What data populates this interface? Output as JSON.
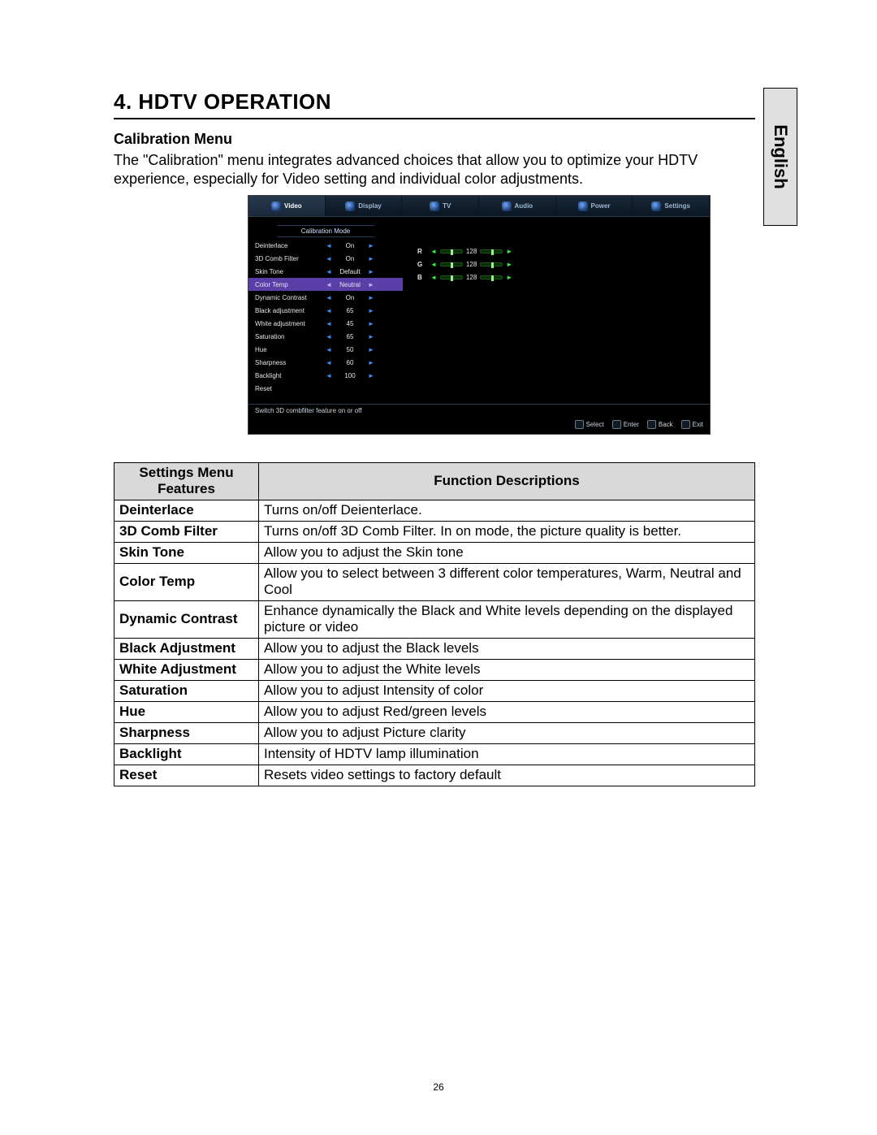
{
  "side_tab": "English",
  "heading": "4.​     HDTV OPERATION",
  "subheading": "Calibration Menu",
  "intro": "The \"Calibration\" menu integrates advanced  choices that allow you to optimize your HDTV experience, especially for Video setting and individual color adjustments.",
  "osd": {
    "tabs": [
      {
        "label": "Video",
        "active": true
      },
      {
        "label": "Display",
        "active": false
      },
      {
        "label": "TV",
        "active": false
      },
      {
        "label": "Audio",
        "active": false
      },
      {
        "label": "Power",
        "active": false
      },
      {
        "label": "Settings",
        "active": false
      }
    ],
    "panel_title": "Calibration Mode",
    "rows": [
      {
        "label": "Deinterlace",
        "value": "On",
        "selected": false,
        "has_arrows": true
      },
      {
        "label": "3D Comb Filter",
        "value": "On",
        "selected": false,
        "has_arrows": true
      },
      {
        "label": "Skin Tone",
        "value": "Default",
        "selected": false,
        "has_arrows": true
      },
      {
        "label": "Color Temp",
        "value": "Neutral",
        "selected": true,
        "has_arrows": true
      },
      {
        "label": "Dynamic Contrast",
        "value": "On",
        "selected": false,
        "has_arrows": true
      },
      {
        "label": "Black adjustment",
        "value": "65",
        "selected": false,
        "has_arrows": true
      },
      {
        "label": "White adjustment",
        "value": "45",
        "selected": false,
        "has_arrows": true
      },
      {
        "label": "Saturation",
        "value": "65",
        "selected": false,
        "has_arrows": true
      },
      {
        "label": "Hue",
        "value": "50",
        "selected": false,
        "has_arrows": true
      },
      {
        "label": "Sharpness",
        "value": "60",
        "selected": false,
        "has_arrows": true
      },
      {
        "label": "Backlight",
        "value": "100",
        "selected": false,
        "has_arrows": true
      },
      {
        "label": "Reset",
        "value": "",
        "selected": false,
        "has_arrows": false
      }
    ],
    "rgb": [
      {
        "ch": "R",
        "val": "128"
      },
      {
        "ch": "G",
        "val": "128"
      },
      {
        "ch": "B",
        "val": "128"
      }
    ],
    "hint": "Switch 3D combfilter feature  on or off",
    "footer": [
      {
        "label": "Select"
      },
      {
        "label": "Enter"
      },
      {
        "label": "Back"
      },
      {
        "label": "Exit"
      }
    ]
  },
  "table": {
    "head_feature": "Settings Menu Features",
    "head_desc": "Function Descriptions",
    "rows": [
      {
        "feature": "Deinterlace",
        "desc": "Turns on/off Deienterlace."
      },
      {
        "feature": "3D Comb Filter",
        "desc": "Turns on/off 3D Comb Filter. In on mode, the picture quality is better."
      },
      {
        "feature": "Skin Tone",
        "desc": "Allow you to adjust the Skin tone"
      },
      {
        "feature": "Color Temp",
        "desc": "Allow you to select between 3 different color temperatures, Warm, Neutral and Cool"
      },
      {
        "feature": "Dynamic Contrast",
        "desc": "Enhance dynamically the Black and White levels depending on the displayed picture or video"
      },
      {
        "feature": "Black Adjustment",
        "desc": "Allow you to adjust the Black levels"
      },
      {
        "feature": "White Adjustment",
        "desc": "Allow you to adjust the White levels"
      },
      {
        "feature": "Saturation",
        "desc": "Allow you to adjust Intensity of color"
      },
      {
        "feature": "Hue",
        "desc": "Allow you to  adjust  Red/green levels"
      },
      {
        "feature": "Sharpness",
        "desc": "Allow you to  adjust  Picture clarity"
      },
      {
        "feature": "Backlight",
        "desc": "Intensity of HDTV lamp illumination"
      },
      {
        "feature": "Reset",
        "desc": "Resets video settings to factory default"
      }
    ]
  },
  "page_number": "26"
}
